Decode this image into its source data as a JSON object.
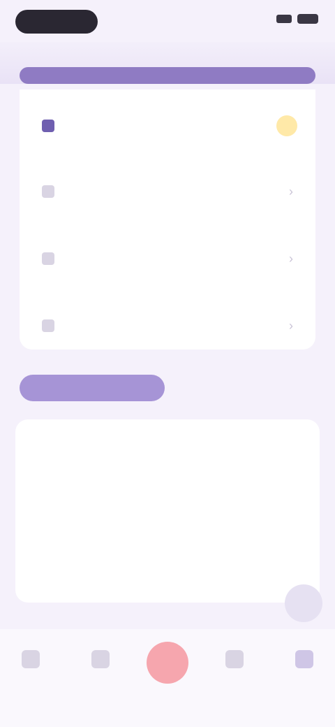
{
  "list": {
    "items": [
      {
        "label": "",
        "icon": "star-icon",
        "icon_color": "#6f5fb0"
      },
      {
        "label": "",
        "icon": "history-icon",
        "icon_color": "#b8b2c6"
      },
      {
        "label": "",
        "icon": "download-icon",
        "icon_color": "#b8b2c6"
      },
      {
        "label": "",
        "icon": "folder-icon",
        "icon_color": "#b8b2c6"
      }
    ]
  },
  "tabs": {
    "active": "",
    "inactive": ""
  },
  "panel": {
    "empty_text": ""
  },
  "nav": {
    "items": [
      {
        "label": ""
      },
      {
        "label": ""
      },
      {
        "label": ""
      },
      {
        "label": ""
      }
    ]
  },
  "colors": {
    "accent": "#8f7bc3",
    "tab_active": "#a694d6",
    "record": "#f6a6ae",
    "badge": "#ffe9a8"
  }
}
